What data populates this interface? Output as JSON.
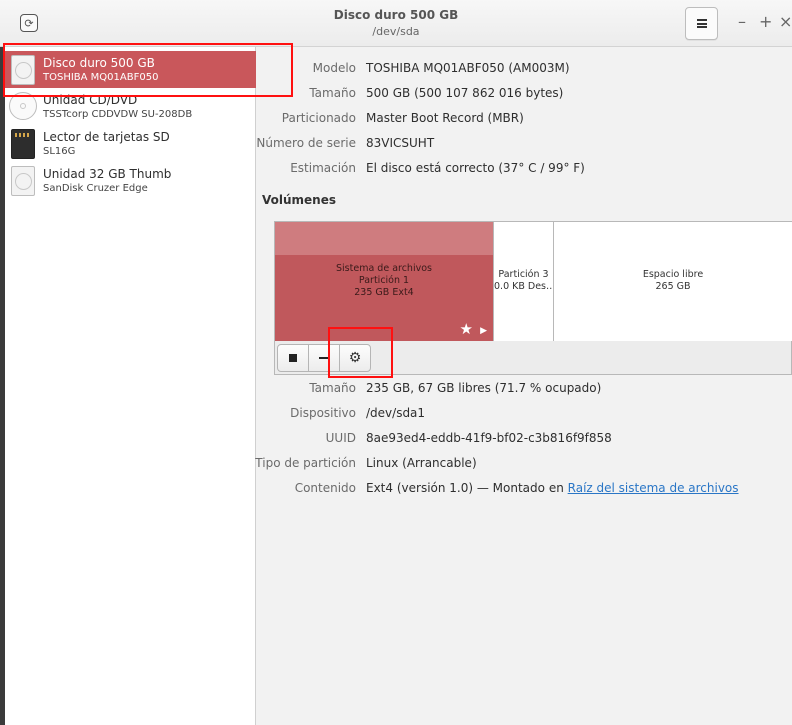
{
  "window": {
    "title": "Disco duro 500 GB",
    "subtitle": "/dev/sda",
    "minimize": "–",
    "maximize": "+",
    "close": "×"
  },
  "sidebar": {
    "items": [
      {
        "name": "Disco duro 500 GB",
        "sub": "TOSHIBA MQ01ABF050",
        "icon": "hard-disk-icon",
        "selected": true
      },
      {
        "name": "Unidad CD/DVD",
        "sub": "TSSTcorp CDDVDW SU-208DB",
        "icon": "optical-drive-icon",
        "selected": false
      },
      {
        "name": "Lector de tarjetas SD",
        "sub": "SL16G",
        "icon": "sd-card-icon",
        "selected": false
      },
      {
        "name": "Unidad 32 GB Thumb",
        "sub": "SanDisk Cruzer Edge",
        "icon": "usb-drive-icon",
        "selected": false
      }
    ]
  },
  "drive": {
    "rows": [
      {
        "label": "Modelo",
        "value": "TOSHIBA MQ01ABF050 (AM003M)"
      },
      {
        "label": "Tamaño",
        "value": "500 GB (500 107 862 016 bytes)"
      },
      {
        "label": "Particionado",
        "value": "Master Boot Record (MBR)"
      },
      {
        "label": "Número de serie",
        "value": "83VICSUHT"
      },
      {
        "label": "Estimación",
        "value": "El disco está correcto (37° C / 99° F)"
      }
    ]
  },
  "volumes": {
    "heading": "Volúmenes",
    "segments": [
      {
        "line1": "Sistema de archivos",
        "line2": "Partición 1",
        "line3": "235 GB Ext4"
      },
      {
        "line1": "Partición 3",
        "line2": "0.0 KB Des…"
      },
      {
        "line1": "Espacio libre",
        "line2": "265 GB"
      }
    ],
    "toolbar": {
      "stop_icon": "stop-icon",
      "remove_icon": "minus-icon",
      "settings_icon": "gear-icon"
    }
  },
  "partition": {
    "rows": [
      {
        "label": "Tamaño",
        "value": "235 GB, 67 GB libres (71.7 % ocupado)"
      },
      {
        "label": "Dispositivo",
        "value": "/dev/sda1"
      },
      {
        "label": "UUID",
        "value": "8ae93ed4-eddb-41f9-bf02-c3b816f9f858"
      },
      {
        "label": "Tipo de partición",
        "value": "Linux (Arrancable)"
      }
    ],
    "contents_label": "Contenido",
    "contents_prefix": "Ext4 (versión 1.0) — Montado en",
    "contents_link": "Raíz del sistema de archivos"
  },
  "colors": {
    "selection": "#c9575b",
    "partition_fill": "#c0585c",
    "annotation": "#ff1010",
    "link": "#2a76c6"
  }
}
